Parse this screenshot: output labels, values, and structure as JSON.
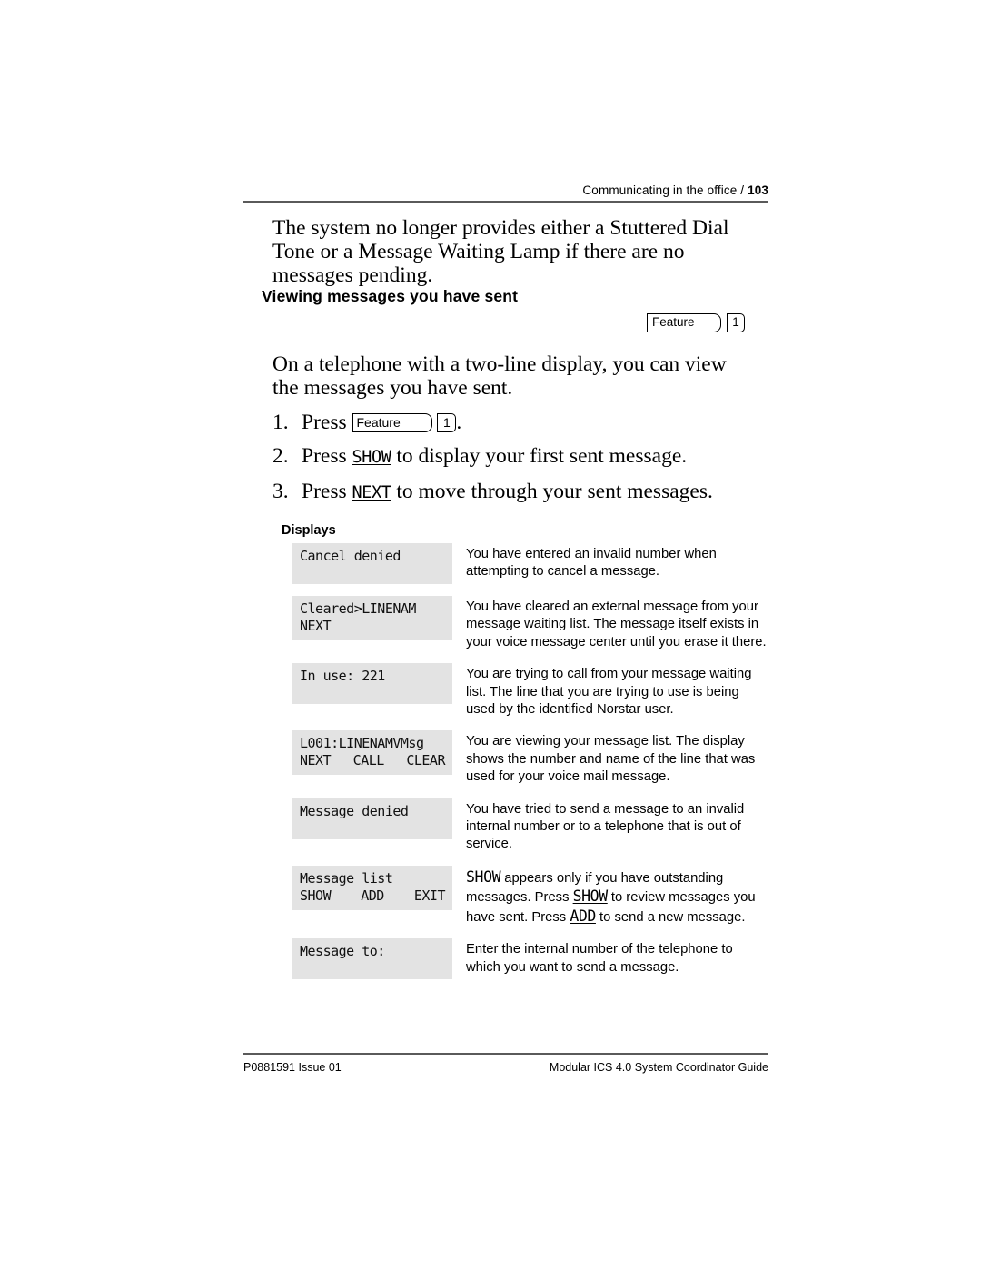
{
  "header": {
    "running_head": "Communicating in the office / ",
    "page_number": "103"
  },
  "intro_paragraph": "The system no longer provides either a Stuttered Dial Tone or a Message Waiting Lamp if there are no messages pending.",
  "section": {
    "heading": "Viewing messages you have sent",
    "feature_key_label": "Feature",
    "feature_key_digit": "1"
  },
  "body_paragraph": "On a telephone with a two-line display, you can view the messages you have sent.",
  "steps": [
    {
      "number": "1.",
      "prefix": "Press ",
      "feature_label": "Feature",
      "digit": "1",
      "suffix": "."
    },
    {
      "number": "2.",
      "prefix": "Press ",
      "token": "SHOW",
      "suffix": " to display your first sent message."
    },
    {
      "number": "3.",
      "prefix": "Press ",
      "token": "NEXT",
      "suffix": " to move through your sent messages."
    }
  ],
  "displays": {
    "heading": "Displays",
    "rows": [
      {
        "lcd_line1": "Cancel denied",
        "softkeys": [],
        "description": "You have entered an invalid number when attempting to cancel a message."
      },
      {
        "lcd_line1": "Cleared>LINENAM",
        "softkeys": [
          "NEXT"
        ],
        "description": "You have cleared an external message from your message waiting list. The message itself exists in your voice message center until you erase it there."
      },
      {
        "lcd_line1": "In use: 221",
        "softkeys": [],
        "description": "You are trying to call from your message waiting list. The line that you are trying to use is being used by the identified Norstar user."
      },
      {
        "lcd_line1": "L001:LINENAMVMsg",
        "softkeys": [
          "NEXT",
          "CALL",
          "CLEAR"
        ],
        "description": "You are viewing your message list. The display shows the number and name of the line that was used for your voice mail message."
      },
      {
        "lcd_line1": "Message denied",
        "softkeys": [],
        "description": "You have tried to send a message to an invalid internal number or to a telephone that is out of service."
      },
      {
        "lcd_line1": "Message list",
        "softkeys": [
          "SHOW",
          "ADD",
          "EXIT"
        ],
        "description_parts": {
          "t1": "SHOW",
          "p1": " appears only if you have outstanding messages. Press ",
          "t2": "SHOW",
          "p2": " to review messages you have sent. Press ",
          "t3": "ADD",
          "p3": " to send a new message."
        }
      },
      {
        "lcd_line1": "Message to:",
        "softkeys": [],
        "description": "Enter the internal number of the telephone to which you want to send a message."
      }
    ]
  },
  "footer": {
    "left": "P0881591 Issue 01",
    "right": "Modular ICS 4.0 System Coordinator Guide"
  }
}
